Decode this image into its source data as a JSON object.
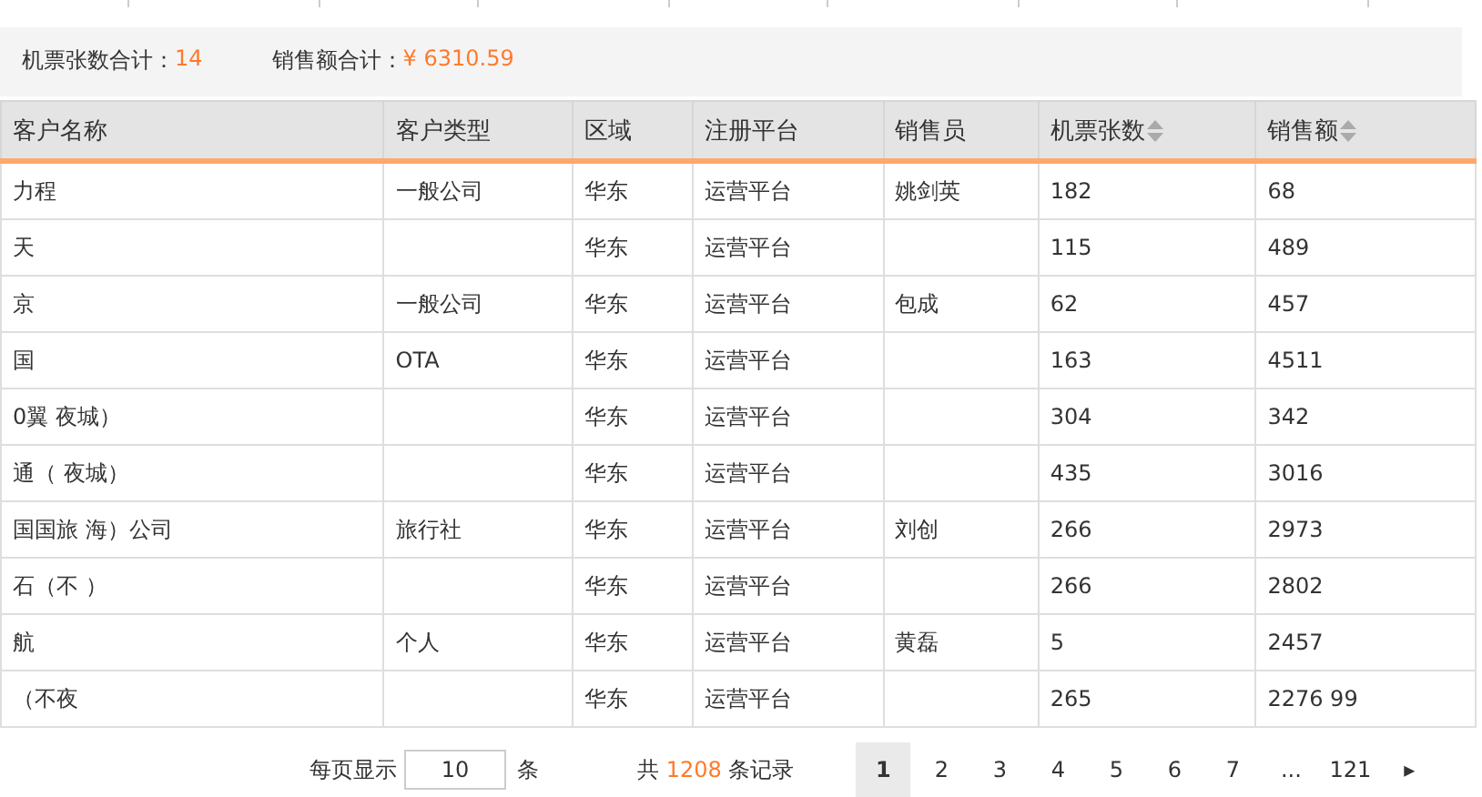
{
  "filters": [
    {
      "kind": "input"
    },
    {
      "kind": "input"
    },
    {
      "kind": "input"
    },
    {
      "kind": "input"
    }
  ],
  "summary": [
    {
      "label": "机票张数合计：",
      "value": "14"
    },
    {
      "label": "销售额合计：",
      "value": "¥ 6310.59"
    }
  ],
  "table": {
    "columns": [
      {
        "label": "客户名称",
        "sortable": false
      },
      {
        "label": "客户类型",
        "sortable": false
      },
      {
        "label": "区域",
        "sortable": false
      },
      {
        "label": "注册平台",
        "sortable": false
      },
      {
        "label": "销售员",
        "sortable": false
      },
      {
        "label": "机票张数",
        "sortable": true
      },
      {
        "label": "销售额",
        "sortable": true
      }
    ],
    "rows": [
      [
        "力程",
        "一般公司",
        "华东",
        "运营平台",
        "姚剑英",
        "182",
        "68"
      ],
      [
        "天",
        "",
        "华东",
        "运营平台",
        "",
        "115",
        "489"
      ],
      [
        "京",
        "一般公司",
        "华东",
        "运营平台",
        "包成",
        "62",
        "457"
      ],
      [
        "国",
        "OTA",
        "华东",
        "运营平台",
        "",
        "163",
        "4511"
      ],
      [
        "0翼 夜城）",
        "",
        "华东",
        "运营平台",
        "",
        "304",
        "342"
      ],
      [
        "通（ 夜城）",
        "",
        "华东",
        "运营平台",
        "",
        "435",
        "3016"
      ],
      [
        "国国旅 海）公司",
        "旅行社",
        "华东",
        "运营平台",
        "刘创",
        "266",
        "2973"
      ],
      [
        "石（不 ）",
        "",
        "华东",
        "运营平台",
        "",
        "266",
        "2802"
      ],
      [
        "航",
        "个人",
        "华东",
        "运营平台",
        "黄磊",
        "5",
        "2457"
      ],
      [
        "（不夜",
        "",
        "华东",
        "运营平台",
        "",
        "265",
        "2276 99"
      ]
    ]
  },
  "pagination": {
    "page_size_label": "每页显示",
    "page_size": "10",
    "unit": "条",
    "total_prefix": "共",
    "total": "1208",
    "total_suffix": "条记录",
    "pages": [
      {
        "label": "1",
        "selected": true
      },
      {
        "label": "2",
        "selected": false
      },
      {
        "label": "3",
        "selected": false
      },
      {
        "label": "4",
        "selected": false
      },
      {
        "label": "5",
        "selected": false
      },
      {
        "label": "6",
        "selected": false
      },
      {
        "label": "7",
        "selected": false
      },
      {
        "label": "...",
        "selected": false
      },
      {
        "label": "121",
        "selected": false
      },
      {
        "label": "▸",
        "selected": false
      }
    ]
  }
}
